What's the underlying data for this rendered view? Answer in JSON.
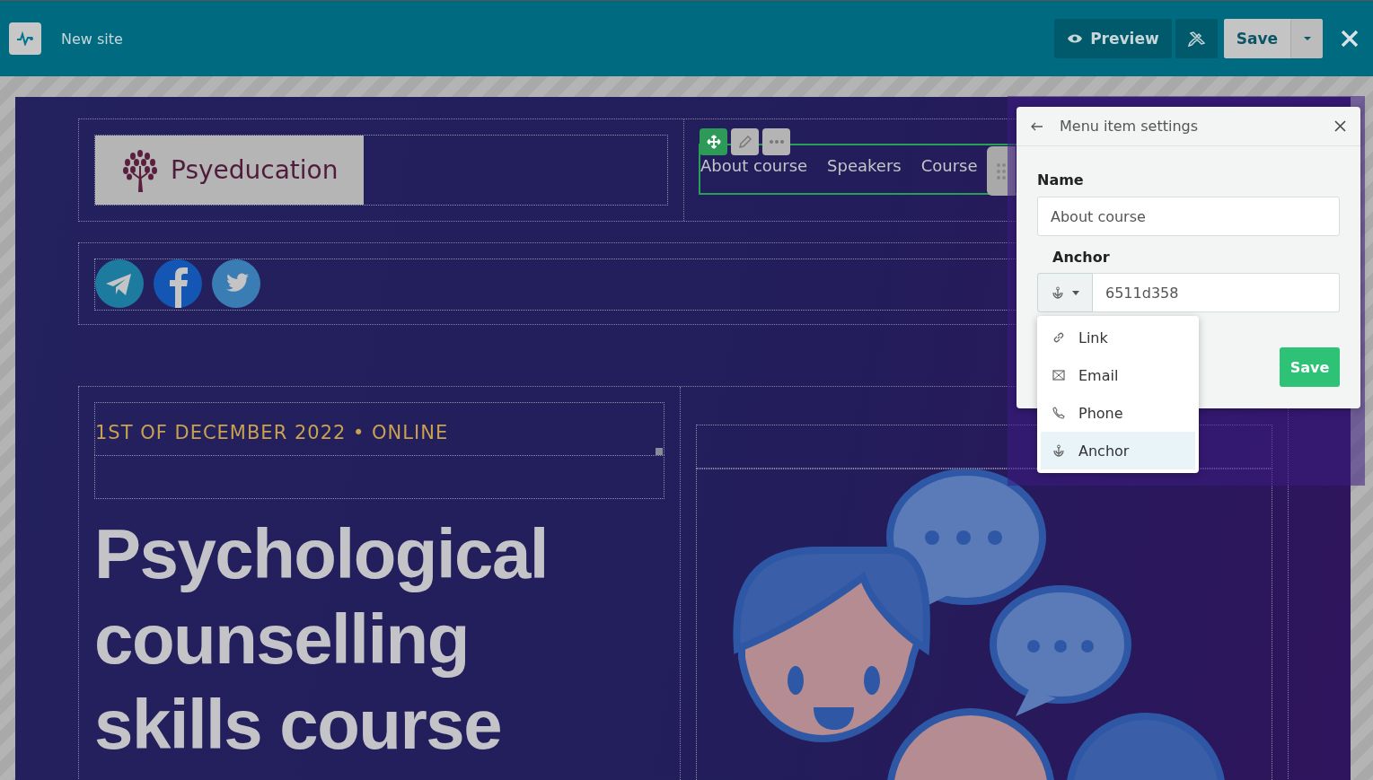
{
  "topbar": {
    "site_name": "New site",
    "preview": "Preview",
    "save": "Save"
  },
  "logo": {
    "text": "Psyeducation"
  },
  "nav": {
    "items": [
      "About course",
      "Speakers",
      "Course"
    ]
  },
  "hero": {
    "tagline": "1ST OF DECEMBER 2022 • ONLINE",
    "heading": "Psychological counselling skills course"
  },
  "settings": {
    "title": "Menu item settings",
    "name_label": "Name",
    "name_value": "About course",
    "anchor_label": "Anchor",
    "anchor_value": "6511d358",
    "save": "Save"
  },
  "link_types": [
    {
      "kind": "link",
      "label": "Link",
      "selected": false
    },
    {
      "kind": "email",
      "label": "Email",
      "selected": false
    },
    {
      "kind": "phone",
      "label": "Phone",
      "selected": false
    },
    {
      "kind": "anchor",
      "label": "Anchor",
      "selected": true
    }
  ]
}
